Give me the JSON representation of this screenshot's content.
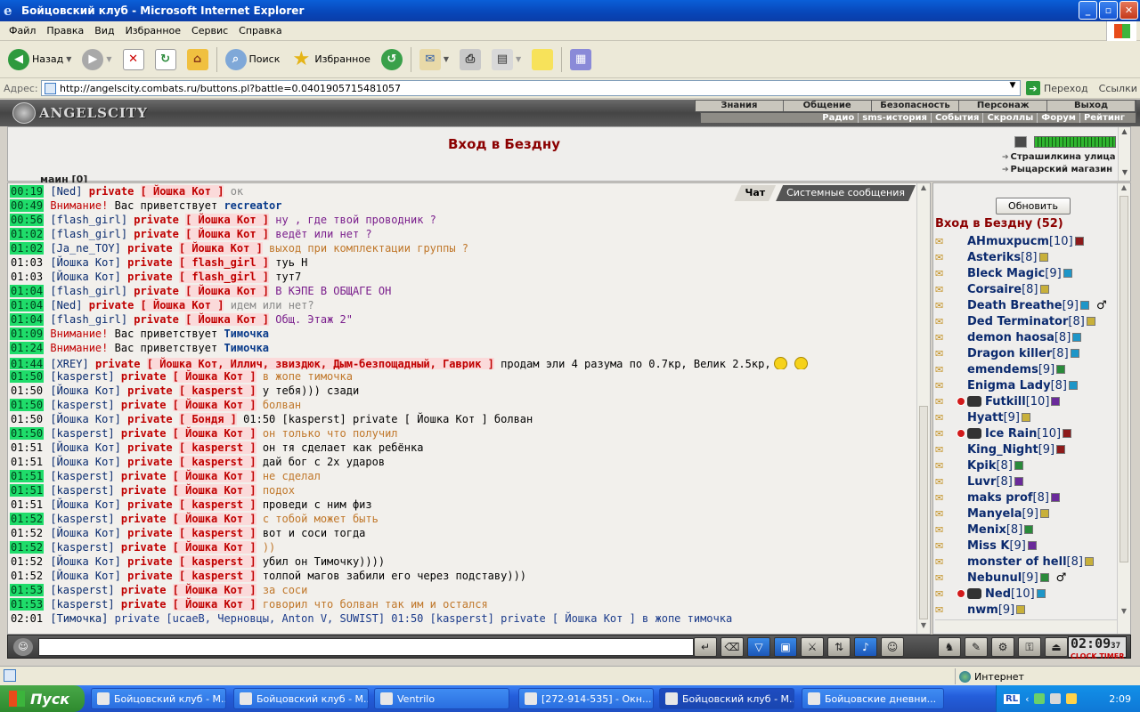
{
  "window": {
    "title": "Бойцовский клуб - Microsoft Internet Explorer",
    "icon": "ie-icon",
    "buttons": {
      "minimize": "_",
      "maximize": "▫",
      "close": "✕"
    }
  },
  "menu": [
    "Файл",
    "Правка",
    "Вид",
    "Избранное",
    "Сервис",
    "Справка"
  ],
  "toolbar": {
    "back": "Назад",
    "search": "Поиск",
    "favorites": "Избранное"
  },
  "address": {
    "label": "Адрес:",
    "url": "http://angelscity.combats.ru/buttons.pl?battle=0.0401905715481057",
    "go": "Переход",
    "links": "Ссылки"
  },
  "site": {
    "logo": "ANGELSCITY",
    "nav_top": [
      "Знания",
      "Общение",
      "Безопасность",
      "Персонаж",
      "Выход"
    ],
    "nav_sub": [
      "Радио",
      "sms-история",
      "События",
      "Скроллы",
      "Форум",
      "Рейтинг"
    ]
  },
  "room": {
    "title": "Вход в Бездну",
    "links": [
      "Страшилкина улица",
      "Рыцарский магазин"
    ],
    "clipped_text": "маин [0]",
    "meter_level": 1.0
  },
  "chat": {
    "tabs": [
      "Чат",
      "Системные сообщения"
    ],
    "lines": [
      {
        "time": "00:19",
        "hl": true,
        "from": "[Ned]",
        "to": "Йошка Кот",
        "msg": "ок",
        "mc": "c-gray"
      },
      {
        "time": "00:49",
        "hl": true,
        "sys": "Внимание!",
        "greet_text": "Вас приветствует",
        "greet_name": "recreator"
      },
      {
        "time": "00:56",
        "hl": true,
        "from": "[flash_girl]",
        "to": "Йошка Кот",
        "msg": "ну , где твой проводник ?",
        "mc": "c-purple"
      },
      {
        "time": "01:02",
        "hl": true,
        "from": "[flash_girl]",
        "to": "Йошка Кот",
        "msg": "ведёт или нет ?",
        "mc": "c-purple"
      },
      {
        "time": "01:02",
        "hl": true,
        "from": "[Ja_ne_TOY]",
        "to": "Йошка Кот",
        "msg": "выход при комплектации группы ?",
        "mc": "c-orange"
      },
      {
        "time": "01:03",
        "hl": false,
        "from": "[Йошка Кот]",
        "to": "flash_girl",
        "msg": "туь Н",
        "mc": "c-black"
      },
      {
        "time": "01:03",
        "hl": false,
        "from": "[Йошка Кот]",
        "to": "flash_girl",
        "msg": "тут7",
        "mc": "c-black"
      },
      {
        "time": "01:04",
        "hl": true,
        "from": "[flash_girl]",
        "to": "Йошка Кот",
        "msg": "В КЭПЕ В ОБЩАГЕ ОН",
        "mc": "c-purple"
      },
      {
        "time": "01:04",
        "hl": true,
        "from": "[Ned]",
        "to": "Йошка Кот",
        "msg": "идем или нет?",
        "mc": "c-gray"
      },
      {
        "time": "01:04",
        "hl": true,
        "from": "[flash_girl]",
        "to": "Йошка Кот",
        "msg": "Общ. Этаж 2\"",
        "mc": "c-purple"
      },
      {
        "time": "01:09",
        "hl": true,
        "sys": "Внимание!",
        "greet_text": "Вас приветствует",
        "greet_name": "Тимочка"
      },
      {
        "time": "01:24",
        "hl": true,
        "sys": "Внимание!",
        "greet_text": "Вас приветствует",
        "greet_name": "Тимочка"
      },
      {
        "time": "01:44",
        "hl": true,
        "from": "[XREY]",
        "to": "Йошка Кот, Иллич, звиздюк, Дым-безпощадный, Гаврик",
        "msg": "продам эли 4 разума по 0.7кр, Велик 2.5кр,",
        "mc": "c-black",
        "smiles": true
      },
      {
        "time": "01:50",
        "hl": true,
        "from": "[kasperst]",
        "to": "Йошка Кот",
        "msg": "в жопе тимочка",
        "mc": "c-orange"
      },
      {
        "time": "01:50",
        "hl": false,
        "from": "[Йошка Кот]",
        "to": "kasperst",
        "msg": "у тебя))) сзади",
        "mc": "c-black"
      },
      {
        "time": "01:50",
        "hl": true,
        "from": "[kasperst]",
        "to": "Йошка Кот",
        "msg": "болван",
        "mc": "c-orange"
      },
      {
        "time": "01:50",
        "hl": false,
        "from": "[Йошка Кот]",
        "to": "Бондя",
        "msg": "01:50 [kasperst] private [ Йошка Кот ] болван",
        "mc": "c-black"
      },
      {
        "time": "01:50",
        "hl": true,
        "from": "[kasperst]",
        "to": "Йошка Кот",
        "msg": "он только что получил",
        "mc": "c-orange"
      },
      {
        "time": "01:51",
        "hl": false,
        "from": "[Йошка Кот]",
        "to": "kasperst",
        "msg": "он тя сделает как ребёнка",
        "mc": "c-black"
      },
      {
        "time": "01:51",
        "hl": false,
        "from": "[Йошка Кот]",
        "to": "kasperst",
        "msg": "дай бог с 2х ударов",
        "mc": "c-black"
      },
      {
        "time": "01:51",
        "hl": true,
        "from": "[kasperst]",
        "to": "Йошка Кот",
        "msg": "не сделал",
        "mc": "c-orange"
      },
      {
        "time": "01:51",
        "hl": true,
        "from": "[kasperst]",
        "to": "Йошка Кот",
        "msg": "подох",
        "mc": "c-orange"
      },
      {
        "time": "01:51",
        "hl": false,
        "from": "[Йошка Кот]",
        "to": "kasperst",
        "msg": "проведи с ним физ",
        "mc": "c-black"
      },
      {
        "time": "01:52",
        "hl": true,
        "from": "[kasperst]",
        "to": "Йошка Кот",
        "msg": "с тобой может быть",
        "mc": "c-orange"
      },
      {
        "time": "01:52",
        "hl": false,
        "from": "[Йошка Кот]",
        "to": "kasperst",
        "msg": "вот и соси тогда",
        "mc": "c-black"
      },
      {
        "time": "01:52",
        "hl": true,
        "from": "[kasperst]",
        "to": "Йошка Кот",
        "msg": "))",
        "mc": "c-orange"
      },
      {
        "time": "01:52",
        "hl": false,
        "from": "[Йошка Кот]",
        "to": "kasperst",
        "msg": "убил он Тимочку))))",
        "mc": "c-black"
      },
      {
        "time": "01:52",
        "hl": false,
        "from": "[Йошка Кот]",
        "to": "kasperst",
        "msg": "толпой магов забили его через подставу)))",
        "mc": "c-black"
      },
      {
        "time": "01:53",
        "hl": true,
        "from": "[kasperst]",
        "to": "Йошка Кот",
        "msg": "за соси",
        "mc": "c-orange"
      },
      {
        "time": "01:53",
        "hl": true,
        "from": "[kasperst]",
        "to": "Йошка Кот",
        "msg": "говорил что болван так им и остался",
        "mc": "c-orange"
      },
      {
        "time": "02:01",
        "hl": false,
        "plain": true,
        "from": "[Тимочка]",
        "msg": "private [ucaeB, Черновцы, Anton V, SUWIST] 01:50 [kasperst] private [ Йошка Кот ] в жопе тимочка",
        "mc": "c-blue"
      }
    ]
  },
  "userlist": {
    "refresh": "Обновить",
    "title": "Вход в Бездну (52)",
    "users": [
      {
        "name": "AHmuxpucm",
        "lvl": "[10]",
        "info": "i-r"
      },
      {
        "name": "Asteriks",
        "lvl": "[8]",
        "info": "i-y"
      },
      {
        "name": "Bleck Magic",
        "lvl": "[9]",
        "info": "i-c"
      },
      {
        "name": "Corsaire",
        "lvl": "[8]",
        "info": "i-y"
      },
      {
        "name": "Death Breathe",
        "lvl": "[9]",
        "info": "i-c",
        "extra": "♂"
      },
      {
        "name": "Ded Terminator",
        "lvl": "[8]",
        "info": "i-y"
      },
      {
        "name": "demon haosa",
        "lvl": "[8]",
        "info": "i-c"
      },
      {
        "name": "Dragon killer",
        "lvl": "[8]",
        "info": "i-c"
      },
      {
        "name": "emendems",
        "lvl": "[9]",
        "info": "i-g"
      },
      {
        "name": "Enigma Lady",
        "lvl": "[8]",
        "info": "i-c"
      },
      {
        "name": "Futkill",
        "lvl": "[10]",
        "info": "i-p",
        "badge": true,
        "emb": true
      },
      {
        "name": "Hyatt",
        "lvl": "[9]",
        "info": "i-y",
        "indent": true
      },
      {
        "name": "Ice Rain",
        "lvl": "[10]",
        "info": "i-r",
        "badge": true,
        "emb": true
      },
      {
        "name": "King_Night",
        "lvl": "[9]",
        "info": "i-r"
      },
      {
        "name": "Kpik",
        "lvl": "[8]",
        "info": "i-g"
      },
      {
        "name": "Luvr",
        "lvl": "[8]",
        "info": "i-p"
      },
      {
        "name": "maks prof",
        "lvl": "[8]",
        "info": "i-p"
      },
      {
        "name": "Manyela",
        "lvl": "[9]",
        "info": "i-y"
      },
      {
        "name": "Menix",
        "lvl": "[8]",
        "info": "i-g"
      },
      {
        "name": "Miss K",
        "lvl": "[9]",
        "info": "i-p"
      },
      {
        "name": "monster of hell",
        "lvl": "[8]",
        "info": "i-y"
      },
      {
        "name": "Nebunul",
        "lvl": "[9]",
        "info": "i-g",
        "extra": "♂"
      },
      {
        "name": "Ned",
        "lvl": "[10]",
        "info": "i-c",
        "badge": true,
        "emb": true
      },
      {
        "name": "nwm",
        "lvl": "[9]",
        "info": "i-y"
      }
    ]
  },
  "clock": {
    "time": "02:09",
    "seconds": "37",
    "labels": "CLOCK TIMER"
  },
  "status": {
    "zone": "Интернет"
  },
  "taskbar": {
    "start": "Пуск",
    "tasks": [
      "Бойцовский клуб - M...",
      "Бойцовский клуб - M...",
      "Ventrilo",
      "[272-914-535] - Окн...",
      "Бойцовский клуб - M...",
      "Бойцовские дневни..."
    ],
    "lang": "RL",
    "time": "2:09"
  }
}
